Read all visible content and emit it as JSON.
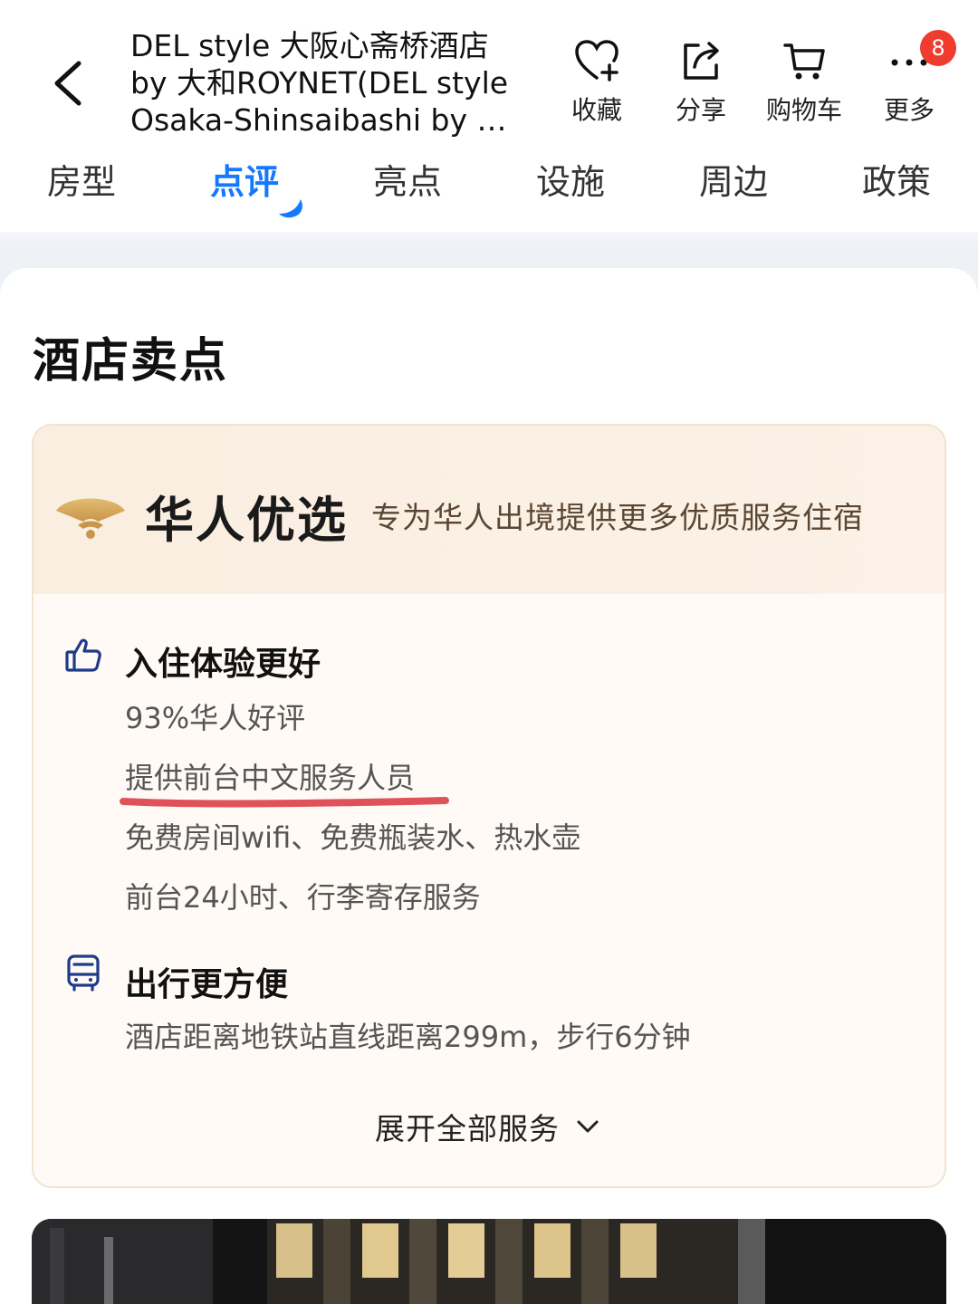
{
  "header": {
    "back_icon": "chevron-left-icon",
    "title": "DEL style 大阪心斋桥酒店 by 大和ROYNET(DEL style Osaka-Shinsaibashi by …",
    "actions": [
      {
        "label": "收藏",
        "icon": "heart-plus-icon"
      },
      {
        "label": "分享",
        "icon": "share-icon"
      },
      {
        "label": "购物车",
        "icon": "cart-icon"
      },
      {
        "label": "更多",
        "icon": "more-dots-icon"
      }
    ],
    "more_badge": "8"
  },
  "tabs": [
    {
      "label": "房型",
      "active": false
    },
    {
      "label": "点评",
      "active": true
    },
    {
      "label": "亮点",
      "active": false
    },
    {
      "label": "设施",
      "active": false
    },
    {
      "label": "周边",
      "active": false
    },
    {
      "label": "政策",
      "active": false
    }
  ],
  "section": {
    "title": "酒店卖点",
    "brand": "华人优选",
    "brand_desc": "专为华人出境提供更多优质服务住宿",
    "groups": [
      {
        "icon": "thumbs-up-icon",
        "title": "入住体验更好",
        "items": [
          "93%华人好评",
          "提供前台中文服务人员",
          "免费房间wifi、免费瓶装水、热水壶",
          "前台24小时、行李寄存服务"
        ]
      },
      {
        "icon": "bus-icon",
        "title": "出行更方便",
        "items": [
          "酒店距离地铁站直线距离299m，步行6分钟"
        ]
      }
    ],
    "expand_label": "展开全部服务"
  },
  "colors": {
    "accent": "#1677ff",
    "badge": "#f03c2e",
    "highlight_underline": "#e0525a",
    "brand_gold": "#d4a95a"
  }
}
